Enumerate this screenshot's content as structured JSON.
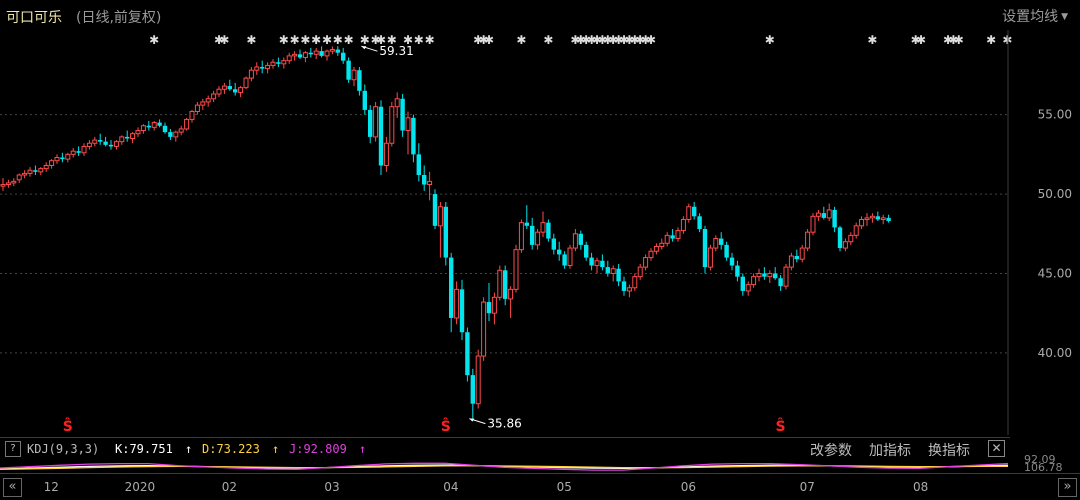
{
  "header": {
    "title": "可口可乐",
    "subtitle": "(日线,前复权)",
    "settings_label": "设置均线"
  },
  "indicator": {
    "name": "KDJ(9,3,3)",
    "k_label": "K:79.751",
    "k_arrow": "↑",
    "d_label": "D:73.223",
    "d_arrow": "↑",
    "j_label": "J:92.809",
    "j_arrow": "↑",
    "buttons": [
      "改参数",
      "加指标",
      "换指标"
    ],
    "help": "?",
    "close": "✕",
    "side_labels": [
      "92.09",
      "106.78"
    ]
  },
  "nav": {
    "prev": "«",
    "next": "»"
  },
  "colors": {
    "up": "#ff4b4b",
    "down": "#00e5ee",
    "grid": "#444444",
    "axis_text": "#aaaaaa",
    "k_line": "#ffffff",
    "d_line": "#ffd23c",
    "j_line": "#e040e0",
    "annotation": "#ffffff"
  },
  "chart_data": {
    "type": "candlestick",
    "title": "可口可乐",
    "y_ticks": [
      40,
      45,
      50,
      55
    ],
    "y_tick_labels": [
      "40.00",
      "45.00",
      "50.00",
      "55.00"
    ],
    "ylim": [
      34.83,
      60.33
    ],
    "x_ticks": [
      "12",
      "2020",
      "02",
      "03",
      "04",
      "05",
      "06",
      "07",
      "08"
    ],
    "x_tick_index": [
      9,
      24,
      42,
      61,
      83,
      104,
      127,
      149,
      170
    ],
    "annotations": [
      {
        "label": "59.31",
        "index": 66,
        "value": 59.31
      },
      {
        "label": "35.86",
        "index": 86,
        "value": 35.86
      }
    ],
    "star_marks": [
      28,
      40,
      41,
      46,
      52,
      54,
      56,
      58,
      60,
      62,
      64,
      67,
      69,
      70,
      72,
      75,
      77,
      79,
      88,
      89,
      90,
      96,
      101,
      106,
      107,
      108,
      109,
      110,
      111,
      112,
      113,
      114,
      115,
      116,
      117,
      118,
      119,
      120,
      142,
      161,
      169,
      170,
      175,
      176,
      177,
      183,
      186
    ],
    "s_marks": [
      12,
      82,
      144
    ],
    "ohlc_daily": [
      [
        50.5,
        51.0,
        50.2,
        50.6
      ],
      [
        50.6,
        50.9,
        50.4,
        50.7
      ],
      [
        50.7,
        51.0,
        50.5,
        50.8
      ],
      [
        50.9,
        51.3,
        50.7,
        51.2
      ],
      [
        51.2,
        51.5,
        51.0,
        51.3
      ],
      [
        51.3,
        51.7,
        51.1,
        51.5
      ],
      [
        51.5,
        51.8,
        51.2,
        51.4
      ],
      [
        51.4,
        51.7,
        51.2,
        51.6
      ],
      [
        51.6,
        52.0,
        51.4,
        51.8
      ],
      [
        51.8,
        52.2,
        51.6,
        52.1
      ],
      [
        52.1,
        52.5,
        51.9,
        52.3
      ],
      [
        52.3,
        52.6,
        52.0,
        52.2
      ],
      [
        52.2,
        52.6,
        52.0,
        52.5
      ],
      [
        52.5,
        52.9,
        52.3,
        52.7
      ],
      [
        52.7,
        53.0,
        52.4,
        52.6
      ],
      [
        52.6,
        53.2,
        52.4,
        53.0
      ],
      [
        53.0,
        53.4,
        52.8,
        53.2
      ],
      [
        53.2,
        53.6,
        53.0,
        53.4
      ],
      [
        53.4,
        53.8,
        53.1,
        53.3
      ],
      [
        53.3,
        53.6,
        53.0,
        53.1
      ],
      [
        53.1,
        53.4,
        52.8,
        53.0
      ],
      [
        53.0,
        53.4,
        52.8,
        53.3
      ],
      [
        53.3,
        53.7,
        53.1,
        53.6
      ],
      [
        53.6,
        54.0,
        53.3,
        53.5
      ],
      [
        53.5,
        53.9,
        53.2,
        53.8
      ],
      [
        53.8,
        54.2,
        53.6,
        54.0
      ],
      [
        54.0,
        54.4,
        53.8,
        54.3
      ],
      [
        54.3,
        54.6,
        54.0,
        54.2
      ],
      [
        54.2,
        54.6,
        54.0,
        54.5
      ],
      [
        54.5,
        54.7,
        54.2,
        54.3
      ],
      [
        54.3,
        54.5,
        53.8,
        53.9
      ],
      [
        53.9,
        54.1,
        53.4,
        53.6
      ],
      [
        53.6,
        54.0,
        53.3,
        53.9
      ],
      [
        53.9,
        54.3,
        53.7,
        54.1
      ],
      [
        54.1,
        54.8,
        54.0,
        54.7
      ],
      [
        54.7,
        55.3,
        54.5,
        55.2
      ],
      [
        55.2,
        55.8,
        55.0,
        55.6
      ],
      [
        55.6,
        56.0,
        55.3,
        55.8
      ],
      [
        55.8,
        56.2,
        55.5,
        56.0
      ],
      [
        56.0,
        56.5,
        55.8,
        56.3
      ],
      [
        56.3,
        56.8,
        56.1,
        56.6
      ],
      [
        56.6,
        57.0,
        56.3,
        56.8
      ],
      [
        56.8,
        57.2,
        56.5,
        56.6
      ],
      [
        56.6,
        57.0,
        56.2,
        56.4
      ],
      [
        56.4,
        56.8,
        56.1,
        56.7
      ],
      [
        56.7,
        57.4,
        56.6,
        57.3
      ],
      [
        57.3,
        58.0,
        57.1,
        57.8
      ],
      [
        57.8,
        58.3,
        57.5,
        58.0
      ],
      [
        58.0,
        58.4,
        57.6,
        57.9
      ],
      [
        57.9,
        58.3,
        57.6,
        58.1
      ],
      [
        58.1,
        58.5,
        57.9,
        58.3
      ],
      [
        58.3,
        58.6,
        58.0,
        58.2
      ],
      [
        58.2,
        58.6,
        57.9,
        58.4
      ],
      [
        58.4,
        58.9,
        58.2,
        58.7
      ],
      [
        58.7,
        59.0,
        58.4,
        58.8
      ],
      [
        58.8,
        59.1,
        58.5,
        58.6
      ],
      [
        58.6,
        59.0,
        58.3,
        58.9
      ],
      [
        58.9,
        59.2,
        58.6,
        58.8
      ],
      [
        58.8,
        59.2,
        58.5,
        59.0
      ],
      [
        59.0,
        59.3,
        58.6,
        58.7
      ],
      [
        58.7,
        59.1,
        58.4,
        59.0
      ],
      [
        59.0,
        59.3,
        58.8,
        59.1
      ],
      [
        59.1,
        59.31,
        58.7,
        58.9
      ],
      [
        58.9,
        59.2,
        58.2,
        58.4
      ],
      [
        58.4,
        58.6,
        57.0,
        57.2
      ],
      [
        57.2,
        58.0,
        56.8,
        57.8
      ],
      [
        57.8,
        58.0,
        56.2,
        56.5
      ],
      [
        56.5,
        56.9,
        55.0,
        55.3
      ],
      [
        55.3,
        55.6,
        53.2,
        53.6
      ],
      [
        53.6,
        55.8,
        53.3,
        55.5
      ],
      [
        55.5,
        55.9,
        51.2,
        51.8
      ],
      [
        51.8,
        53.6,
        51.4,
        53.2
      ],
      [
        53.2,
        55.8,
        53.0,
        55.5
      ],
      [
        55.5,
        56.4,
        54.8,
        56.0
      ],
      [
        56.0,
        56.3,
        53.6,
        54.0
      ],
      [
        54.0,
        55.2,
        52.5,
        54.8
      ],
      [
        54.8,
        55.0,
        52.0,
        52.5
      ],
      [
        52.5,
        53.2,
        50.8,
        51.2
      ],
      [
        51.2,
        51.8,
        50.2,
        50.6
      ],
      [
        50.6,
        51.4,
        49.6,
        50.8
      ],
      [
        50.0,
        50.3,
        47.8,
        48.0
      ],
      [
        48.0,
        49.5,
        46.0,
        49.2
      ],
      [
        49.2,
        49.5,
        45.5,
        46.0
      ],
      [
        46.0,
        46.3,
        41.3,
        42.2
      ],
      [
        42.2,
        44.5,
        41.8,
        44.0
      ],
      [
        44.0,
        44.6,
        40.8,
        41.3
      ],
      [
        41.3,
        41.6,
        38.2,
        38.6
      ],
      [
        38.6,
        39.0,
        35.86,
        36.8
      ],
      [
        36.8,
        40.2,
        36.5,
        39.8
      ],
      [
        39.8,
        43.5,
        39.5,
        43.2
      ],
      [
        43.2,
        44.4,
        42.0,
        42.5
      ],
      [
        42.5,
        43.8,
        41.8,
        43.5
      ],
      [
        43.5,
        45.5,
        43.3,
        45.2
      ],
      [
        45.2,
        45.5,
        43.0,
        43.4
      ],
      [
        43.4,
        44.2,
        42.2,
        44.0
      ],
      [
        44.0,
        46.8,
        43.8,
        46.5
      ],
      [
        46.5,
        48.4,
        46.3,
        48.2
      ],
      [
        48.2,
        49.3,
        47.8,
        48.0
      ],
      [
        48.0,
        48.5,
        46.5,
        46.8
      ],
      [
        46.8,
        47.8,
        46.5,
        47.6
      ],
      [
        47.6,
        48.9,
        47.3,
        48.2
      ],
      [
        48.2,
        48.4,
        47.0,
        47.2
      ],
      [
        47.2,
        47.5,
        46.2,
        46.5
      ],
      [
        46.5,
        47.0,
        45.8,
        46.2
      ],
      [
        46.2,
        46.4,
        45.3,
        45.5
      ],
      [
        45.5,
        46.8,
        45.3,
        46.6
      ],
      [
        46.6,
        47.8,
        46.4,
        47.5
      ],
      [
        47.5,
        47.7,
        46.5,
        46.8
      ],
      [
        46.8,
        47.0,
        45.8,
        46.0
      ],
      [
        46.0,
        46.3,
        45.2,
        45.5
      ],
      [
        45.5,
        46.0,
        45.0,
        45.8
      ],
      [
        45.8,
        46.2,
        45.2,
        45.4
      ],
      [
        45.4,
        45.8,
        44.8,
        45.0
      ],
      [
        45.0,
        45.5,
        44.5,
        45.3
      ],
      [
        45.3,
        45.6,
        44.2,
        44.5
      ],
      [
        44.5,
        44.8,
        43.6,
        43.9
      ],
      [
        43.9,
        44.3,
        43.5,
        44.1
      ],
      [
        44.1,
        45.0,
        43.9,
        44.8
      ],
      [
        44.8,
        45.6,
        44.6,
        45.4
      ],
      [
        45.4,
        46.2,
        45.2,
        46.0
      ],
      [
        46.0,
        46.6,
        45.8,
        46.4
      ],
      [
        46.4,
        46.9,
        46.2,
        46.7
      ],
      [
        46.7,
        47.2,
        46.5,
        46.9
      ],
      [
        46.9,
        47.6,
        46.7,
        47.4
      ],
      [
        47.4,
        47.8,
        47.0,
        47.2
      ],
      [
        47.2,
        47.9,
        47.0,
        47.7
      ],
      [
        47.7,
        48.6,
        47.5,
        48.4
      ],
      [
        48.4,
        49.4,
        48.2,
        49.2
      ],
      [
        49.2,
        49.5,
        48.4,
        48.6
      ],
      [
        48.6,
        48.8,
        47.6,
        47.8
      ],
      [
        47.8,
        48.0,
        45.0,
        45.4
      ],
      [
        45.4,
        46.8,
        45.2,
        46.6
      ],
      [
        46.6,
        47.4,
        46.4,
        47.2
      ],
      [
        47.2,
        47.6,
        46.5,
        46.8
      ],
      [
        46.8,
        47.0,
        45.8,
        46.0
      ],
      [
        46.0,
        46.3,
        45.2,
        45.5
      ],
      [
        45.5,
        45.8,
        44.5,
        44.8
      ],
      [
        44.8,
        45.0,
        43.6,
        43.9
      ],
      [
        43.9,
        44.5,
        43.6,
        44.3
      ],
      [
        44.3,
        45.0,
        44.1,
        44.8
      ],
      [
        44.8,
        45.3,
        44.5,
        45.0
      ],
      [
        45.0,
        45.4,
        44.6,
        44.8
      ],
      [
        44.8,
        45.2,
        44.4,
        45.0
      ],
      [
        45.0,
        45.4,
        44.6,
        44.7
      ],
      [
        44.7,
        44.9,
        43.9,
        44.2
      ],
      [
        44.2,
        45.6,
        44.0,
        45.4
      ],
      [
        45.4,
        46.3,
        45.2,
        46.1
      ],
      [
        46.1,
        46.5,
        45.7,
        45.9
      ],
      [
        45.9,
        46.8,
        45.7,
        46.6
      ],
      [
        46.6,
        47.8,
        46.4,
        47.6
      ],
      [
        47.6,
        48.8,
        47.4,
        48.6
      ],
      [
        48.6,
        49.0,
        48.3,
        48.8
      ],
      [
        48.8,
        49.2,
        48.4,
        48.5
      ],
      [
        48.5,
        49.4,
        48.3,
        49.0
      ],
      [
        49.0,
        49.2,
        47.6,
        47.9
      ],
      [
        47.9,
        48.0,
        46.4,
        46.6
      ],
      [
        46.6,
        47.2,
        46.4,
        47.0
      ],
      [
        47.0,
        47.6,
        46.8,
        47.4
      ],
      [
        47.4,
        48.2,
        47.2,
        48.0
      ],
      [
        48.0,
        48.6,
        47.8,
        48.4
      ],
      [
        48.4,
        48.8,
        48.0,
        48.5
      ],
      [
        48.5,
        48.8,
        48.2,
        48.6
      ],
      [
        48.6,
        48.9,
        48.3,
        48.4
      ],
      [
        48.4,
        48.7,
        48.1,
        48.5
      ],
      [
        48.5,
        48.7,
        48.2,
        48.3
      ]
    ],
    "kdj_series": [
      {
        "name": "K",
        "values": [
          55,
          60,
          66,
          72,
          76,
          78,
          74,
          70,
          66,
          62,
          60,
          64,
          70,
          76,
          80,
          82,
          78,
          72,
          68,
          64,
          60,
          58,
          62,
          68,
          74,
          78,
          80,
          79,
          76,
          72,
          68,
          66,
          70,
          75,
          79.751
        ]
      },
      {
        "name": "D",
        "values": [
          52,
          55,
          59,
          64,
          68,
          71,
          72,
          71,
          69,
          66,
          64,
          64,
          66,
          69,
          73,
          76,
          77,
          75,
          73,
          70,
          67,
          64,
          63,
          64,
          67,
          71,
          74,
          76,
          76,
          75,
          72,
          70,
          70,
          72,
          73.223
        ]
      },
      {
        "name": "J",
        "values": [
          61,
          70,
          80,
          88,
          92,
          92,
          78,
          68,
          60,
          54,
          52,
          64,
          78,
          90,
          94,
          94,
          80,
          66,
          58,
          52,
          46,
          46,
          60,
          76,
          88,
          92,
          92,
          85,
          76,
          66,
          60,
          58,
          70,
          81,
          92.809
        ]
      }
    ]
  }
}
